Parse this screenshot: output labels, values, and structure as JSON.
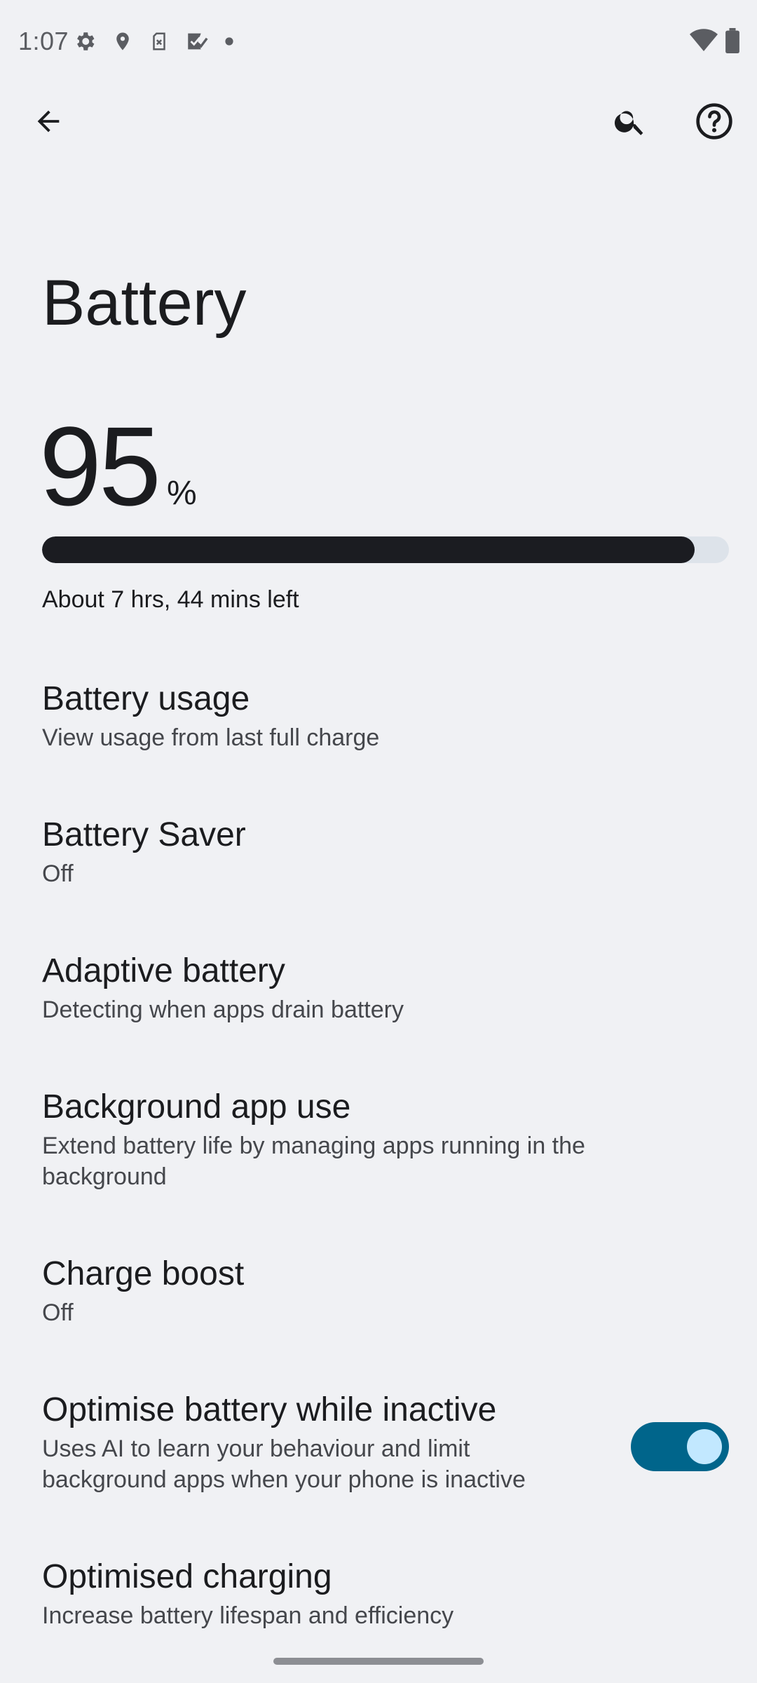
{
  "status_bar": {
    "time": "1:07",
    "left_icons": [
      "gear-icon",
      "location-icon",
      "sim-off-icon",
      "task-check-icon",
      "dot-icon"
    ],
    "right_icons": [
      "wifi-icon",
      "battery-icon"
    ]
  },
  "top_bar": {
    "icons": [
      "back-arrow-icon",
      "search-icon",
      "help-icon"
    ]
  },
  "page": {
    "title": "Battery"
  },
  "battery": {
    "level": "95",
    "unit": "%",
    "level_fraction": 0.95,
    "estimate": "About 7 hrs, 44 mins left"
  },
  "settings": [
    {
      "title": "Battery usage",
      "summary": "View usage from last full charge"
    },
    {
      "title": "Battery Saver",
      "summary": "Off"
    },
    {
      "title": "Adaptive battery",
      "summary": "Detecting when apps drain battery"
    },
    {
      "title": "Background app use",
      "summary": "Extend battery life by managing apps running in the background"
    },
    {
      "title": "Charge boost",
      "summary": "Off"
    },
    {
      "title": "Optimise battery while inactive",
      "summary": "Uses AI to learn your behaviour and limit background apps when your phone is inactive",
      "toggle_on": true
    },
    {
      "title": "Optimised charging",
      "summary": "Increase battery lifespan and efficiency"
    }
  ],
  "colors": {
    "background": "#f0f1f4",
    "text_primary": "#1b1c1f",
    "text_secondary": "#45474c",
    "toggle_track": "#00658b",
    "toggle_knob": "#c2e8ff",
    "bar_fill": "#1b1c21",
    "bar_track": "#dde3ea"
  }
}
